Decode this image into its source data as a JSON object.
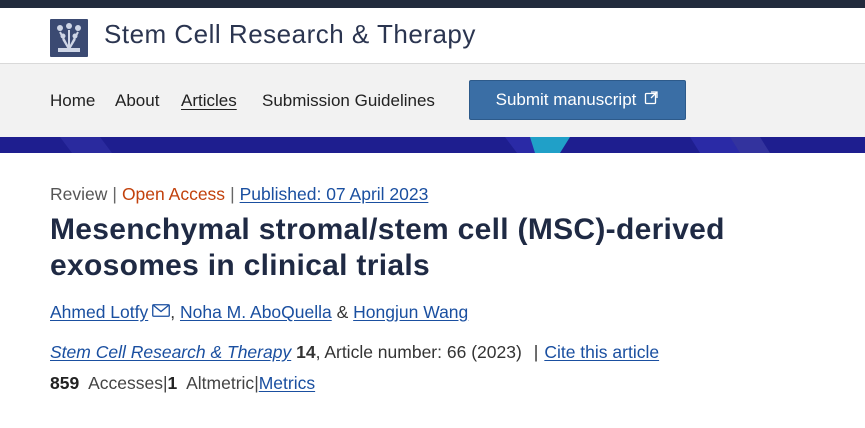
{
  "header": {
    "site_title": "Stem Cell Research & Therapy",
    "logo_icon": "people-tree-icon"
  },
  "nav": {
    "items": [
      "Home",
      "About",
      "Articles",
      "Submission Guidelines"
    ],
    "active": "Articles",
    "submit_label": "Submit manuscript",
    "submit_icon": "external-link-icon"
  },
  "article": {
    "type": "Review",
    "access": "Open Access",
    "published": "Published: 07 April 2023",
    "title": "Mesenchymal stromal/stem cell (MSC)-derived exosomes in clinical trials",
    "authors": [
      "Ahmed Lotfy",
      "Noha M. AboQuella",
      "Hongjun Wang"
    ],
    "journal": "Stem Cell Research & Therapy",
    "volume": "14",
    "article_number": ", Article number: 66 (2023)",
    "cite_label": "Cite this article",
    "accesses_count": "859",
    "accesses_label": "Accesses",
    "altmetric_count": "1",
    "altmetric_label": "Altmetric",
    "metrics_label": "Metrics"
  },
  "colors": {
    "brand_dark": "#2b3550",
    "button_blue": "#3a6ea5",
    "link_blue": "#1a4fa0",
    "open_access_orange": "#c2410c",
    "band_blue": "#1e1e8f"
  }
}
